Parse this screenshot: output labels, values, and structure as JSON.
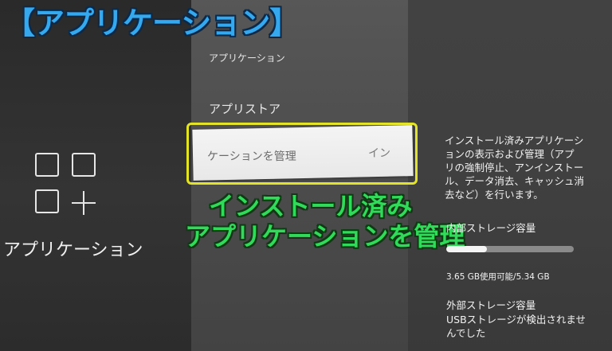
{
  "banner": {
    "text": "【アプリケーション】",
    "color": "#36a8ee"
  },
  "left": {
    "icon": "apps-grid-plus-icon",
    "label": "アプリケーション"
  },
  "center": {
    "header": "アプリケーション",
    "section": "アプリストア",
    "selected_item": {
      "label": "ケーションを管理",
      "right_text": "イン"
    },
    "highlight_color": "#e3e32a"
  },
  "overlay_caption": {
    "line1": "インストール済み",
    "line2": "アプリケーションを管理",
    "color": "#33d95a"
  },
  "right": {
    "description_lines": [
      "インストール済みアプリケーシ",
      "ョンの表示および管理（アプ",
      "リの強制停止、アンインストー",
      "ル、データ消去、キャッシュ消",
      "去など）を行います。"
    ],
    "internal_storage": {
      "title": "内部ストレージ容量",
      "usage_text": "3.65 GB使用可能/5.34 GB",
      "used_fraction": 0.32
    },
    "external_storage": {
      "title": "外部ストレージ容量",
      "message_lines": [
        "USBストレージが検出されませ",
        "んでした"
      ]
    }
  }
}
